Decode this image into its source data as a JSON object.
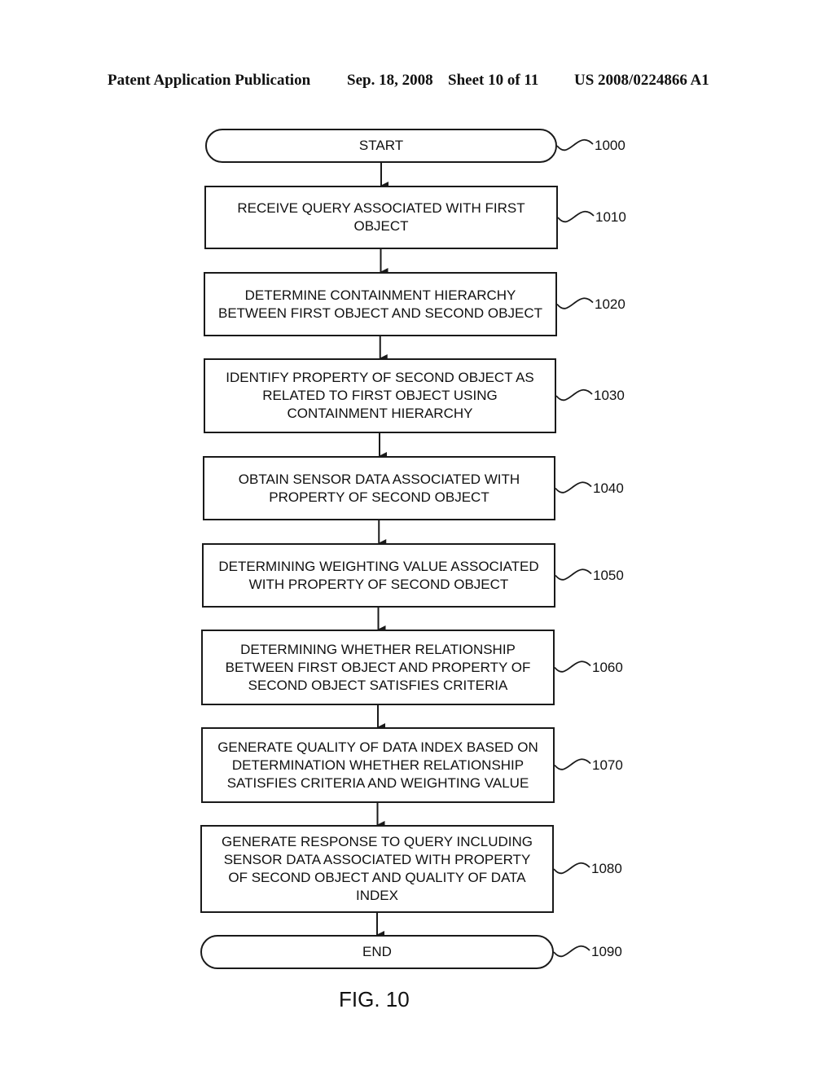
{
  "header": {
    "publication": "Patent Application Publication",
    "date": "Sep. 18, 2008",
    "sheet": "Sheet 10 of 11",
    "number": "US 2008/0224866 A1"
  },
  "flowchart": {
    "nodes": [
      {
        "id": "1000",
        "type": "terminal",
        "text": "START",
        "ref": "1000"
      },
      {
        "id": "1010",
        "type": "process",
        "text": "RECEIVE QUERY ASSOCIATED WITH FIRST\nOBJECT",
        "ref": "1010"
      },
      {
        "id": "1020",
        "type": "process",
        "text": "DETERMINE CONTAINMENT HIERARCHY\nBETWEEN FIRST OBJECT AND SECOND OBJECT",
        "ref": "1020"
      },
      {
        "id": "1030",
        "type": "process",
        "text": "IDENTIFY PROPERTY OF SECOND OBJECT AS\nRELATED TO FIRST OBJECT USING\nCONTAINMENT HIERARCHY",
        "ref": "1030"
      },
      {
        "id": "1040",
        "type": "process",
        "text": "OBTAIN SENSOR DATA ASSOCIATED WITH\nPROPERTY OF SECOND OBJECT",
        "ref": "1040"
      },
      {
        "id": "1050",
        "type": "process",
        "text": "DETERMINING WEIGHTING VALUE ASSOCIATED\nWITH PROPERTY OF SECOND OBJECT",
        "ref": "1050"
      },
      {
        "id": "1060",
        "type": "process",
        "text": "DETERMINING WHETHER RELATIONSHIP\nBETWEEN FIRST OBJECT AND PROPERTY OF\nSECOND OBJECT SATISFIES CRITERIA",
        "ref": "1060"
      },
      {
        "id": "1070",
        "type": "process",
        "text": "GENERATE QUALITY OF DATA INDEX BASED ON\nDETERMINATION WHETHER RELATIONSHIP\nSATISFIES CRITERIA AND WEIGHTING VALUE",
        "ref": "1070"
      },
      {
        "id": "1080",
        "type": "process",
        "text": "GENERATE RESPONSE TO QUERY INCLUDING\nSENSOR DATA ASSOCIATED WITH PROPERTY\nOF SECOND OBJECT AND QUALITY OF DATA\nINDEX",
        "ref": "1080"
      },
      {
        "id": "1090",
        "type": "terminal",
        "text": "END",
        "ref": "1090"
      }
    ],
    "edges": [
      [
        "1000",
        "1010"
      ],
      [
        "1010",
        "1020"
      ],
      [
        "1020",
        "1030"
      ],
      [
        "1030",
        "1040"
      ],
      [
        "1040",
        "1050"
      ],
      [
        "1050",
        "1060"
      ],
      [
        "1060",
        "1070"
      ],
      [
        "1070",
        "1080"
      ],
      [
        "1080",
        "1090"
      ]
    ]
  },
  "figure_label": "FIG. 10"
}
